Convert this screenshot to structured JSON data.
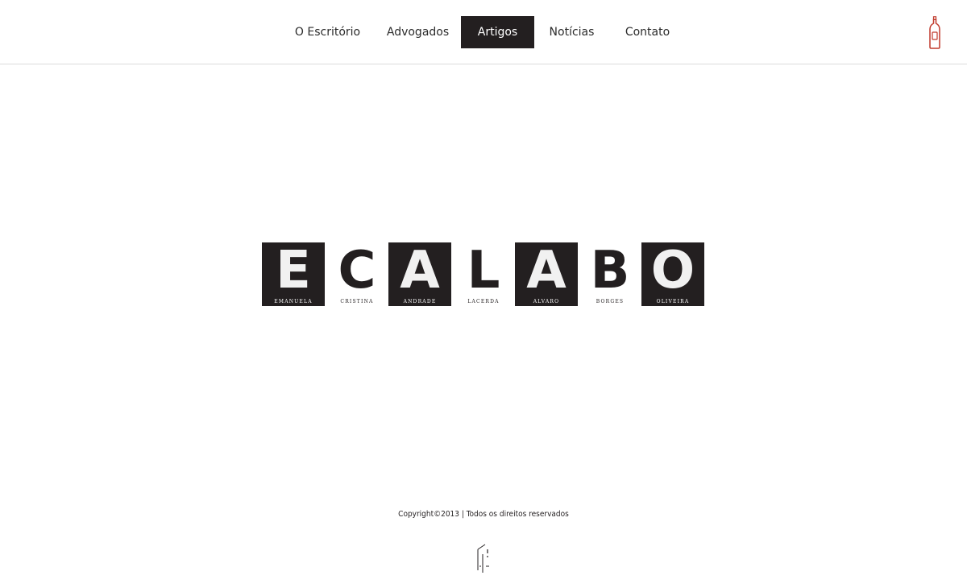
{
  "nav": {
    "items": [
      {
        "label": "O Escritório",
        "active": false
      },
      {
        "label": "Advogados",
        "active": false
      },
      {
        "label": "Artigos",
        "active": true
      },
      {
        "label": "Notícias",
        "active": false
      },
      {
        "label": "Contato",
        "active": false
      }
    ]
  },
  "header": {
    "icon": "wine-bottle-icon",
    "icon_color": "#c0392b"
  },
  "logo": {
    "tiles": [
      {
        "letter": "E",
        "name": "EMANUELA",
        "style": "dark"
      },
      {
        "letter": "C",
        "name": "CRISTINA",
        "style": "light"
      },
      {
        "letter": "A",
        "name": "ANDRADE",
        "style": "dark"
      },
      {
        "letter": "L",
        "name": "LACERDA",
        "style": "light"
      },
      {
        "letter": "A",
        "name": "ALVARO",
        "style": "dark"
      },
      {
        "letter": "B",
        "name": "BORGES",
        "style": "light"
      },
      {
        "letter": "O",
        "name": "OLIVEIRA",
        "style": "dark"
      }
    ]
  },
  "footer": {
    "copyright": "Copyright©2013 | Todos os direitos reservados",
    "icon": "developer-logo-icon"
  },
  "colors": {
    "dark": "#231f20",
    "active_nav_bg": "#231f20",
    "accent": "#c0392b"
  }
}
